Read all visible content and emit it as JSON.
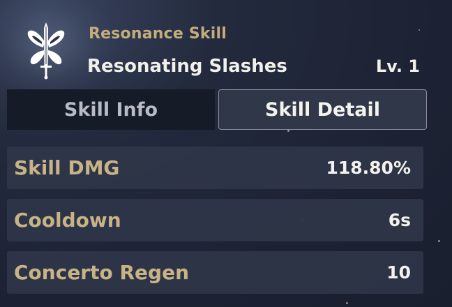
{
  "skill": {
    "type": "Resonance Skill",
    "name": "Resonating Slashes",
    "level": "Lv. 1",
    "icon": "butterfly-sword-icon"
  },
  "tabs": [
    {
      "label": "Skill Info",
      "active": false
    },
    {
      "label": "Skill Detail",
      "active": true
    }
  ],
  "stats": [
    {
      "label": "Skill DMG",
      "value": "118.80%"
    },
    {
      "label": "Cooldown",
      "value": "6s"
    },
    {
      "label": "Concerto Regen",
      "value": "10"
    }
  ],
  "colors": {
    "accent_gold": "#c4ad7c",
    "text_white": "#f2f0ea",
    "panel_bg": "#1c2233",
    "row_bg": "#30374a"
  }
}
